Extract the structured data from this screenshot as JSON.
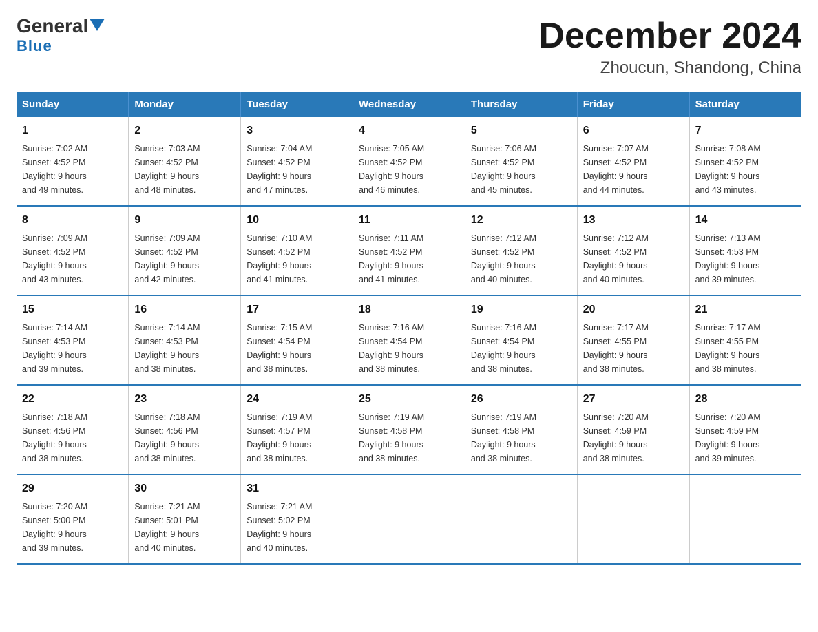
{
  "header": {
    "logo_general": "General",
    "logo_blue": "Blue",
    "month_title": "December 2024",
    "location": "Zhoucun, Shandong, China"
  },
  "weekdays": [
    "Sunday",
    "Monday",
    "Tuesday",
    "Wednesday",
    "Thursday",
    "Friday",
    "Saturday"
  ],
  "weeks": [
    [
      {
        "day": "1",
        "sunrise": "7:02 AM",
        "sunset": "4:52 PM",
        "daylight": "9 hours and 49 minutes."
      },
      {
        "day": "2",
        "sunrise": "7:03 AM",
        "sunset": "4:52 PM",
        "daylight": "9 hours and 48 minutes."
      },
      {
        "day": "3",
        "sunrise": "7:04 AM",
        "sunset": "4:52 PM",
        "daylight": "9 hours and 47 minutes."
      },
      {
        "day": "4",
        "sunrise": "7:05 AM",
        "sunset": "4:52 PM",
        "daylight": "9 hours and 46 minutes."
      },
      {
        "day": "5",
        "sunrise": "7:06 AM",
        "sunset": "4:52 PM",
        "daylight": "9 hours and 45 minutes."
      },
      {
        "day": "6",
        "sunrise": "7:07 AM",
        "sunset": "4:52 PM",
        "daylight": "9 hours and 44 minutes."
      },
      {
        "day": "7",
        "sunrise": "7:08 AM",
        "sunset": "4:52 PM",
        "daylight": "9 hours and 43 minutes."
      }
    ],
    [
      {
        "day": "8",
        "sunrise": "7:09 AM",
        "sunset": "4:52 PM",
        "daylight": "9 hours and 43 minutes."
      },
      {
        "day": "9",
        "sunrise": "7:09 AM",
        "sunset": "4:52 PM",
        "daylight": "9 hours and 42 minutes."
      },
      {
        "day": "10",
        "sunrise": "7:10 AM",
        "sunset": "4:52 PM",
        "daylight": "9 hours and 41 minutes."
      },
      {
        "day": "11",
        "sunrise": "7:11 AM",
        "sunset": "4:52 PM",
        "daylight": "9 hours and 41 minutes."
      },
      {
        "day": "12",
        "sunrise": "7:12 AM",
        "sunset": "4:52 PM",
        "daylight": "9 hours and 40 minutes."
      },
      {
        "day": "13",
        "sunrise": "7:12 AM",
        "sunset": "4:52 PM",
        "daylight": "9 hours and 40 minutes."
      },
      {
        "day": "14",
        "sunrise": "7:13 AM",
        "sunset": "4:53 PM",
        "daylight": "9 hours and 39 minutes."
      }
    ],
    [
      {
        "day": "15",
        "sunrise": "7:14 AM",
        "sunset": "4:53 PM",
        "daylight": "9 hours and 39 minutes."
      },
      {
        "day": "16",
        "sunrise": "7:14 AM",
        "sunset": "4:53 PM",
        "daylight": "9 hours and 38 minutes."
      },
      {
        "day": "17",
        "sunrise": "7:15 AM",
        "sunset": "4:54 PM",
        "daylight": "9 hours and 38 minutes."
      },
      {
        "day": "18",
        "sunrise": "7:16 AM",
        "sunset": "4:54 PM",
        "daylight": "9 hours and 38 minutes."
      },
      {
        "day": "19",
        "sunrise": "7:16 AM",
        "sunset": "4:54 PM",
        "daylight": "9 hours and 38 minutes."
      },
      {
        "day": "20",
        "sunrise": "7:17 AM",
        "sunset": "4:55 PM",
        "daylight": "9 hours and 38 minutes."
      },
      {
        "day": "21",
        "sunrise": "7:17 AM",
        "sunset": "4:55 PM",
        "daylight": "9 hours and 38 minutes."
      }
    ],
    [
      {
        "day": "22",
        "sunrise": "7:18 AM",
        "sunset": "4:56 PM",
        "daylight": "9 hours and 38 minutes."
      },
      {
        "day": "23",
        "sunrise": "7:18 AM",
        "sunset": "4:56 PM",
        "daylight": "9 hours and 38 minutes."
      },
      {
        "day": "24",
        "sunrise": "7:19 AM",
        "sunset": "4:57 PM",
        "daylight": "9 hours and 38 minutes."
      },
      {
        "day": "25",
        "sunrise": "7:19 AM",
        "sunset": "4:58 PM",
        "daylight": "9 hours and 38 minutes."
      },
      {
        "day": "26",
        "sunrise": "7:19 AM",
        "sunset": "4:58 PM",
        "daylight": "9 hours and 38 minutes."
      },
      {
        "day": "27",
        "sunrise": "7:20 AM",
        "sunset": "4:59 PM",
        "daylight": "9 hours and 38 minutes."
      },
      {
        "day": "28",
        "sunrise": "7:20 AM",
        "sunset": "4:59 PM",
        "daylight": "9 hours and 39 minutes."
      }
    ],
    [
      {
        "day": "29",
        "sunrise": "7:20 AM",
        "sunset": "5:00 PM",
        "daylight": "9 hours and 39 minutes."
      },
      {
        "day": "30",
        "sunrise": "7:21 AM",
        "sunset": "5:01 PM",
        "daylight": "9 hours and 40 minutes."
      },
      {
        "day": "31",
        "sunrise": "7:21 AM",
        "sunset": "5:02 PM",
        "daylight": "9 hours and 40 minutes."
      },
      null,
      null,
      null,
      null
    ]
  ],
  "labels": {
    "sunrise": "Sunrise:",
    "sunset": "Sunset:",
    "daylight": "Daylight:"
  }
}
